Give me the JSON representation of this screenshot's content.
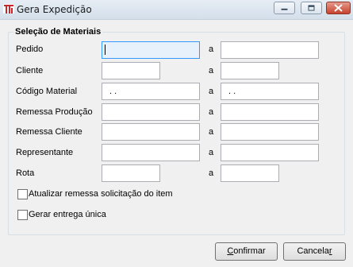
{
  "window": {
    "title": "Gera Expedição"
  },
  "group": {
    "title": "Seleção de Materiais"
  },
  "fields": [
    {
      "label": "Pedido",
      "sep": "a",
      "from_value": "",
      "to_value": ""
    },
    {
      "label": "Cliente",
      "sep": "a",
      "from_value": "",
      "to_value": ""
    },
    {
      "label": "Código Material",
      "sep": "a",
      "from_value": ". .",
      "to_value": ". ."
    },
    {
      "label": "Remessa Produção",
      "sep": "a",
      "from_value": "",
      "to_value": ""
    },
    {
      "label": "Remessa Cliente",
      "sep": "a",
      "from_value": "",
      "to_value": ""
    },
    {
      "label": "Representante",
      "sep": "a",
      "from_value": "",
      "to_value": ""
    },
    {
      "label": "Rota",
      "sep": "a",
      "from_value": "",
      "to_value": ""
    }
  ],
  "options": {
    "update_remessa_label": "Atualizar remessa solicitação do item",
    "update_remessa_checked": false,
    "single_delivery_label": "Gerar entrega única",
    "single_delivery_checked": false
  },
  "buttons": {
    "confirm_first": "C",
    "confirm_rest": "onfirmar",
    "cancel_first": "Cancela",
    "cancel_underlined": "r"
  },
  "icons": {
    "app": "app-logo-icon",
    "minimize": "minimize-icon",
    "maximize": "maximize-icon",
    "close": "close-icon"
  },
  "colors": {
    "focus_border": "#3399ff",
    "close_button": "#c7432f",
    "app_icon": "#c8262b"
  }
}
